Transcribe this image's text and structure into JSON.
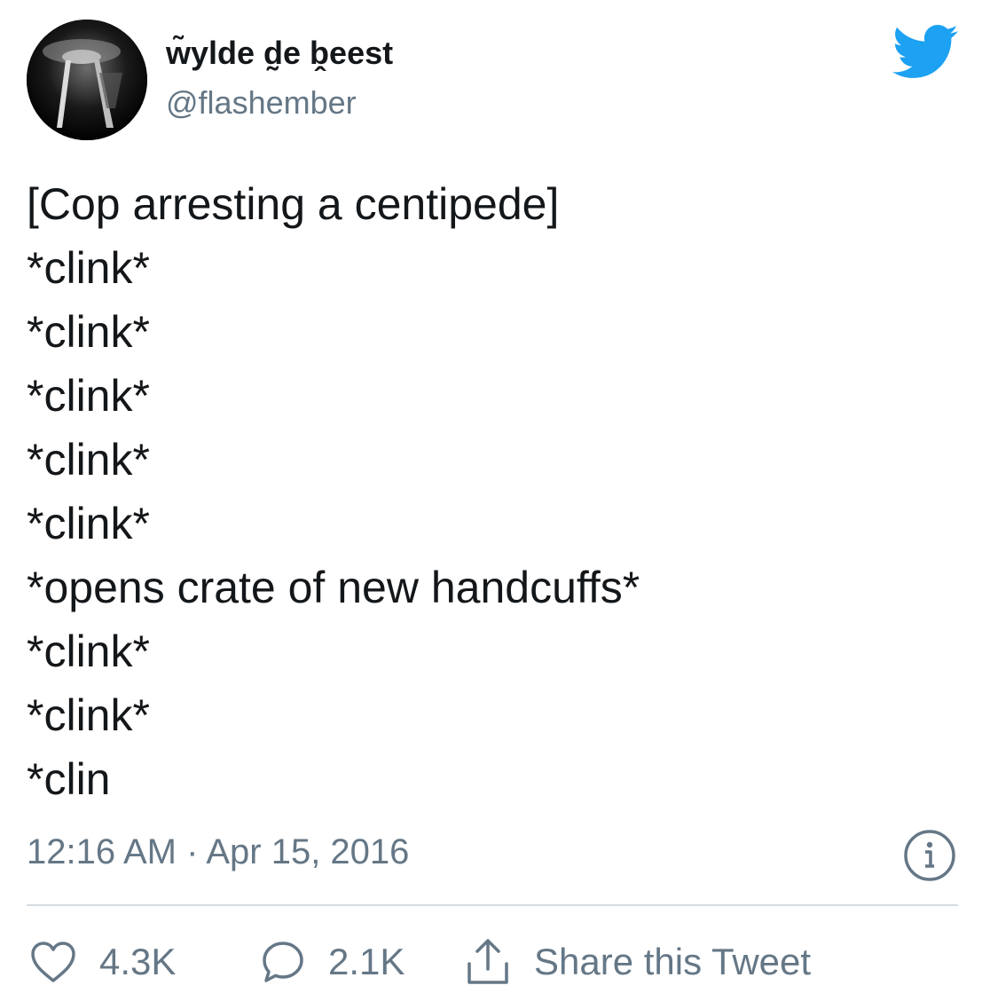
{
  "author": {
    "display_name": "w̃ylde d̰e b̭eest",
    "handle": "@flashember"
  },
  "tweet": {
    "lines": [
      "[Cop arresting a centipede]",
      "*clink*",
      "*clink*",
      "*clink*",
      "*clink*",
      "*clink*",
      "*opens crate of new handcuffs*",
      "*clink*",
      "*clink*",
      "*clin"
    ],
    "timestamp": "12:16 AM · Apr 15, 2016"
  },
  "actions": {
    "likes": "4.3K",
    "replies": "2.1K",
    "share_label": "Share this Tweet"
  },
  "icons": {
    "brand": "twitter-bird-icon",
    "info": "info-icon",
    "like": "heart-icon",
    "reply": "speech-bubble-icon",
    "share": "share-upload-icon"
  },
  "colors": {
    "brand_blue": "#1da1f2",
    "secondary_text": "#657786",
    "primary_text": "#14171a",
    "divider": "#d4dbe0"
  }
}
